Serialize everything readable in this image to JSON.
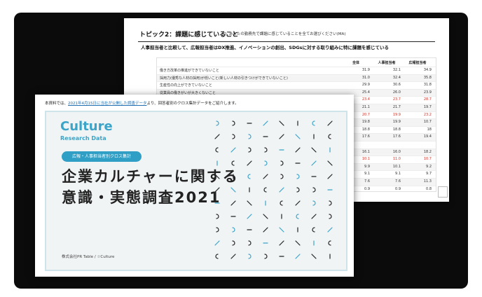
{
  "back_sheet": {
    "topic": "トピック2：課題に感じていること",
    "question": "Q. あなたの勤務先で課題に感じていることを全てお選びください(MA)",
    "subtitle": "人事担当者と比較して、広報担当者はDX推進、イノベーションの創出、SDGsに対する取り組みに特に課題を感じている",
    "table": {
      "headers": [
        "全体",
        "人事担当者",
        "広報担当者"
      ],
      "rows": [
        {
          "label": "働き方改革の推進ができていないこと",
          "values": [
            "31.9",
            "32.1",
            "34.9"
          ],
          "red": false
        },
        {
          "label": "採用力(優秀な人材の採用)が低いこと(新しい人材の引きつけができていないこと)",
          "values": [
            "31.0",
            "32.4",
            "35.8"
          ],
          "red": false
        },
        {
          "label": "生産性の向上ができていないこと",
          "values": [
            "29.9",
            "30.6",
            "31.8"
          ],
          "red": false
        },
        {
          "label": "従業員の働きがいが大きくないこと",
          "values": [
            "25.4",
            "26.0",
            "23.9"
          ],
          "red": false
        },
        {
          "label": "",
          "values": [
            "23.4",
            "23.7",
            "28.7"
          ],
          "red": true
        },
        {
          "label": "",
          "values": [
            "21.1",
            "21.7",
            "19.7"
          ],
          "red": false
        },
        {
          "label": "",
          "values": [
            "20.7",
            "19.9",
            "23.2"
          ],
          "red": true
        },
        {
          "label": "",
          "values": [
            "19.8",
            "19.9",
            "10.7"
          ],
          "red": false
        },
        {
          "label": "",
          "values": [
            "18.8",
            "18.8",
            "18"
          ],
          "red": false
        },
        {
          "label": "",
          "values": [
            "17.6",
            "17.6",
            "19.4"
          ],
          "red": false
        },
        {
          "label": "",
          "values": [
            "",
            "",
            ""
          ],
          "red": false
        },
        {
          "label": "",
          "values": [
            "16.1",
            "16.0",
            "18.2"
          ],
          "red": false
        },
        {
          "label": "",
          "values": [
            "10.1",
            "11.0",
            "10.7"
          ],
          "red": true
        },
        {
          "label": "",
          "values": [
            "9.9",
            "10.1",
            "9.2"
          ],
          "red": false
        },
        {
          "label": "",
          "values": [
            "9.1",
            "9.1",
            "9.7"
          ],
          "red": false
        },
        {
          "label": "",
          "values": [
            "7.6",
            "7.6",
            "11.3"
          ],
          "red": false
        },
        {
          "label": "",
          "values": [
            "0.9",
            "0.9",
            "0.8"
          ],
          "red": false
        }
      ]
    }
  },
  "front_sheet": {
    "note_prefix": "本資料では、",
    "note_link": "2021年4月15日に当社が公開した調査データ",
    "note_suffix": "より、回答者別のクロス集計データをご紹介します。",
    "brand_title": "Culture",
    "brand_subtitle": "Research Data",
    "badge": "広報・人事担当者別クロス集計",
    "title_line1": "企業カルチャーに関する",
    "title_line2": "意識・実態調査2021",
    "company": "株式会社PR Table / ☆Culture"
  },
  "colors": {
    "accent": "#2f9fc6",
    "brand": "#3aa4c9",
    "highlight_red": "#d93025",
    "background_dark": "#0b0b0b"
  }
}
